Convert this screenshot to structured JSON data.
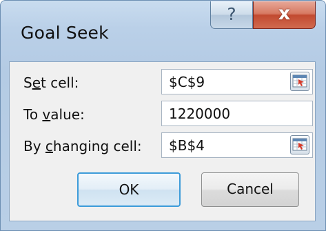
{
  "window": {
    "title": "Goal Seek",
    "help_label": "?",
    "close_label": "x"
  },
  "fields": {
    "set_cell": {
      "label_pre": "S",
      "label_accel": "e",
      "label_post": "t cell:",
      "value": "$C$9"
    },
    "to_value": {
      "label_pre": "To ",
      "label_accel": "v",
      "label_post": "alue:",
      "value": "1220000"
    },
    "by_changing_cell": {
      "label_pre": "By ",
      "label_accel": "c",
      "label_post": "hanging cell:",
      "value": "$B$4"
    }
  },
  "buttons": {
    "ok_label": "OK",
    "cancel_label": "Cancel"
  },
  "icons": {
    "help": "help-icon",
    "close": "close-icon",
    "range_selector": "range-selector-icon"
  },
  "colors": {
    "frame": "#bad0e8",
    "close_button": "#c24a30",
    "ok_focus_border": "#3c9bd9"
  }
}
